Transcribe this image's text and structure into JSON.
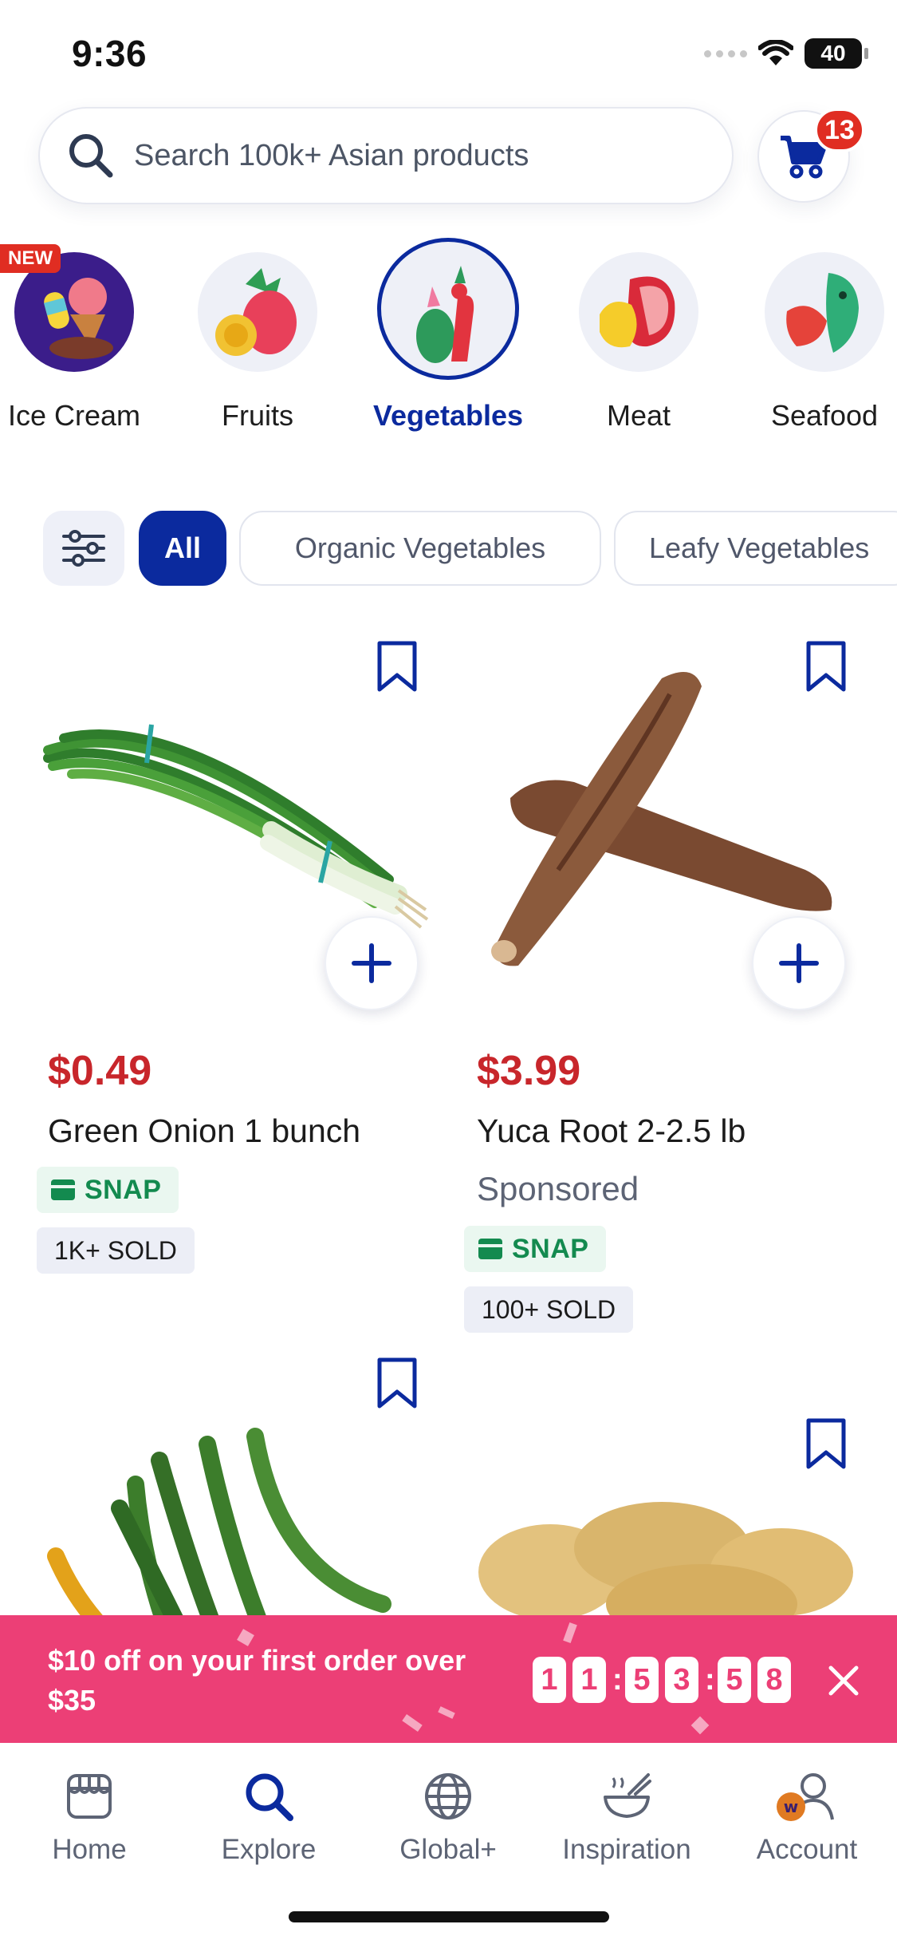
{
  "status_bar": {
    "time": "9:36",
    "battery": "40"
  },
  "search": {
    "placeholder": "Search 100k+ Asian products"
  },
  "cart": {
    "count": "13"
  },
  "categories": [
    {
      "label": "Ice Cream",
      "badge": "NEW",
      "icon": "ice-cream-icon"
    },
    {
      "label": "Fruits",
      "icon": "fruits-icon"
    },
    {
      "label": "Vegetables",
      "icon": "vegetables-icon",
      "selected": true
    },
    {
      "label": "Meat",
      "icon": "meat-icon"
    },
    {
      "label": "Seafood",
      "icon": "seafood-icon"
    }
  ],
  "filters": {
    "chips": [
      "All",
      "Organic Vegetables",
      "Leafy Vegetables"
    ],
    "active": "All"
  },
  "products": [
    {
      "price": "$0.49",
      "name": "Green Onion 1 bunch",
      "snap": "SNAP",
      "sold": "1K+ SOLD"
    },
    {
      "price": "$3.99",
      "name": "Yuca Root 2-2.5 lb",
      "sponsored": "Sponsored",
      "snap": "SNAP",
      "sold": "100+ SOLD"
    },
    {
      "image": "green-chili-peppers"
    },
    {
      "image": "ginger-root"
    }
  ],
  "promo": {
    "text": "$10 off on your first order over $35",
    "countdown": {
      "d1": "1",
      "d2": "1",
      "d3": "5",
      "d4": "3",
      "d5": "5",
      "d6": "8"
    }
  },
  "bottom_nav": [
    {
      "label": "Home",
      "icon": "store-icon"
    },
    {
      "label": "Explore",
      "icon": "search-icon",
      "active": true
    },
    {
      "label": "Global+",
      "icon": "globe-icon"
    },
    {
      "label": "Inspiration",
      "icon": "bowl-icon"
    },
    {
      "label": "Account",
      "icon": "account-icon"
    }
  ],
  "colors": {
    "brand": "#0b2a9e",
    "price": "#c8262b",
    "promo": "#ec3f76",
    "snap": "#138a4f"
  }
}
